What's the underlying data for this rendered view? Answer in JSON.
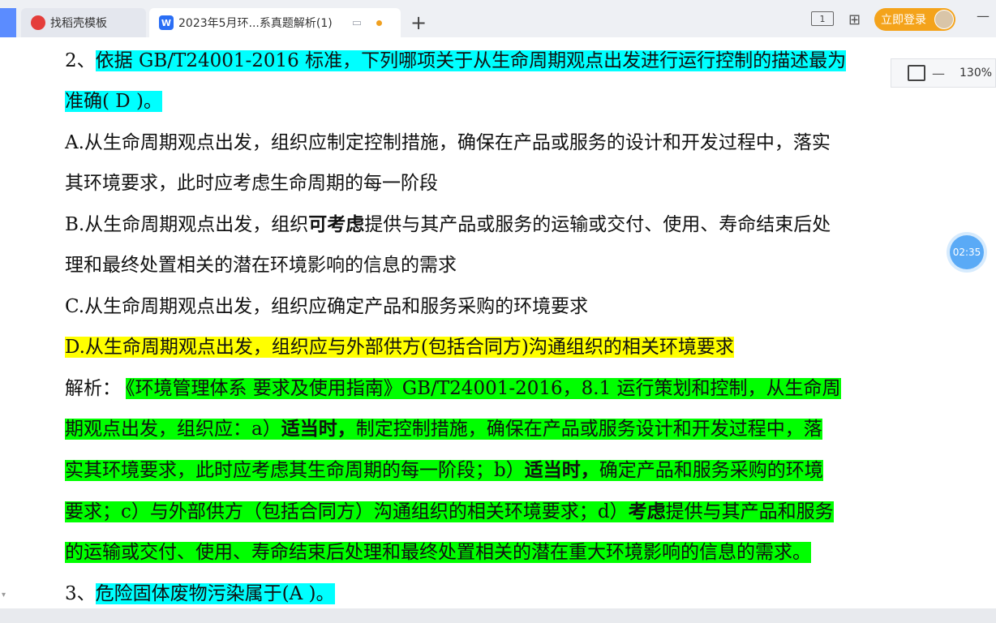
{
  "tabs": [
    {
      "label": "找稻壳模板",
      "logo": "W"
    },
    {
      "label": "2023年5月环...系真题解析(1)",
      "logo": "W"
    }
  ],
  "header": {
    "login_label": "立即登录",
    "view_icon_label": "1"
  },
  "zoom": {
    "value": "130%"
  },
  "timer": "02:35",
  "document": {
    "q2_line1_prefix": "2、",
    "q2_line1_hl": "依据 GB/T24001-2016 标准，下列哪项关于从生命周期观点出发进行运行控制的描述最为",
    "q2_line2_hl": "准确( D )。",
    "a_line1": "A.从生命周期观点出发，组织应制定控制措施，确保在产品或服务的设计和开发过程中，落实",
    "a_line2": "其环境要求，此时应考虑生命周期的每一阶段",
    "b_line1_pre": "B.从生命周期观点出发，组织",
    "b_line1_bold": "可考虑",
    "b_line1_post": "提供与其产品或服务的运输或交付、使用、寿命结束后处",
    "b_line2": "理和最终处置相关的潜在环境影响的信息的需求",
    "c_line": "C.从生命周期观点出发，组织应确定产品和服务采购的环境要求",
    "d_line": "D.从生命周期观点出发，组织应与外部供方(包括合同方)沟通组织的相关环境要求",
    "analysis_label": "解析：",
    "an_line1": "《环境管理体系 要求及使用指南》GB/T24001-2016，8.1 运行策划和控制，从生命周",
    "an_line2_pre": "期观点出发，组织应：a）",
    "an_line2_bold": "适当时，",
    "an_line2_post": "制定控制措施，确保在产品或服务设计和开发过程中，落",
    "an_line3_pre": "实其环境要求，此时应考虑其生命周期的每一阶段；b）",
    "an_line3_bold": "适当时，",
    "an_line3_post": "确定产品和服务采购的环境",
    "an_line4_pre": "要求；c）与外部供方（包括合同方）沟通组织的相关环境要求；d）",
    "an_line4_bold": "考虑",
    "an_line4_post": "提供与其产品和服务",
    "an_line5": "的运输或交付、使用、寿命结束后处理和最终处置相关的潜在重大环境影响的信息的需求。",
    "q3_prefix": "3、",
    "q3_hl": "危险固体废物污染属于(A )。"
  }
}
